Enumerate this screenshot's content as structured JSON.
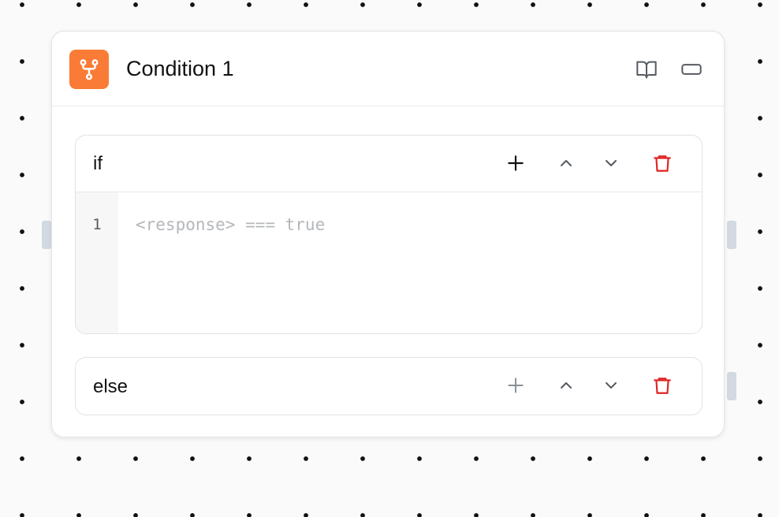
{
  "block": {
    "title": "Condition 1",
    "icon": "condition-branch-icon",
    "accent_color": "#fa7b35",
    "header_icons": [
      "book-open-icon",
      "collapse-rectangle-icon"
    ]
  },
  "conditions": [
    {
      "label": "if",
      "line_number": "1",
      "placeholder": "<response> === true",
      "add_enabled": true
    },
    {
      "label": "else",
      "add_enabled": false
    }
  ],
  "action_icons": [
    "plus-icon",
    "chevron-up-icon",
    "chevron-down-icon",
    "trash-icon"
  ],
  "colors": {
    "delete": "#e02424",
    "canvas_dots": "#111111",
    "handle": "#d3d9e0"
  }
}
